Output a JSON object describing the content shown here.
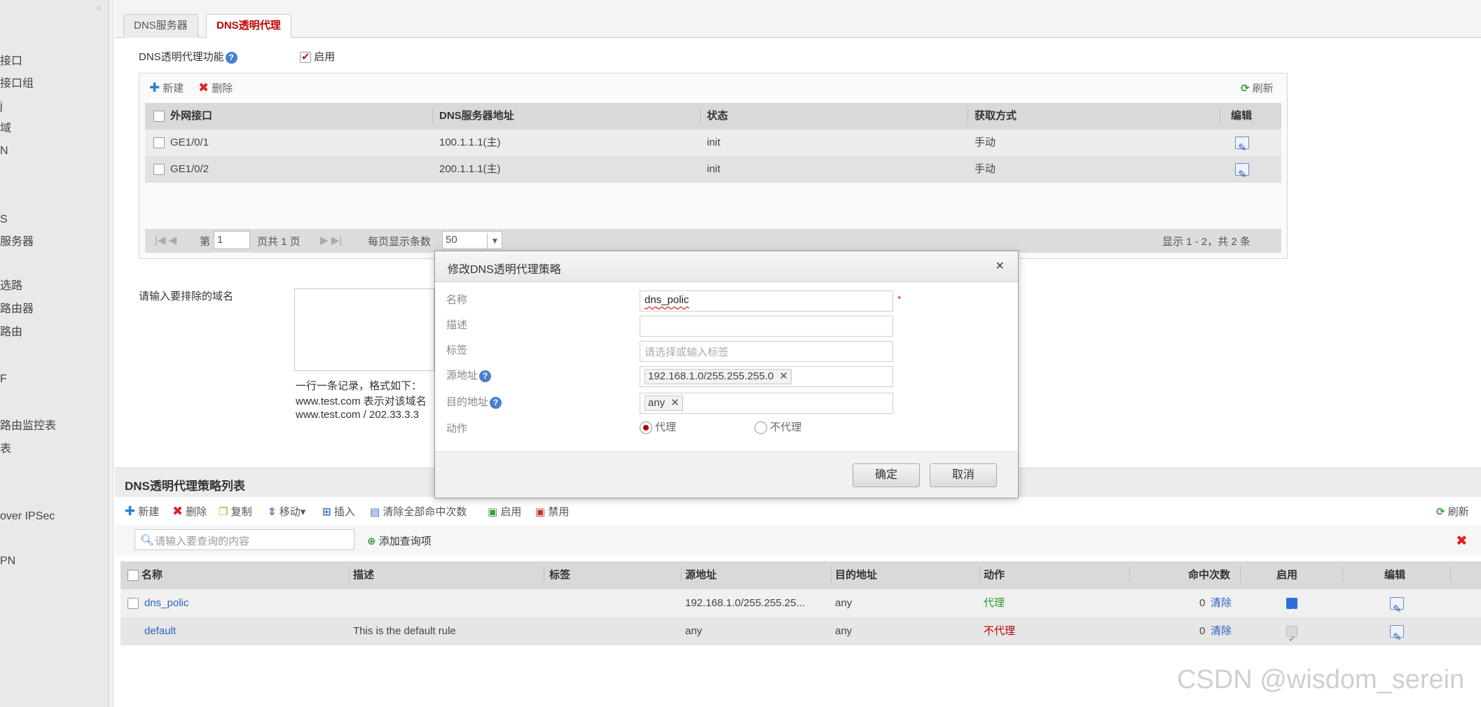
{
  "sidebar": {
    "items": [
      {
        "label": "接口",
        "top": 0
      },
      {
        "label": "接口组"
      },
      {
        "label": "j"
      },
      {
        "label": "域"
      },
      {
        "label": "N"
      },
      {
        "label": "S"
      },
      {
        "label": "服务器"
      },
      {
        "label": "选路"
      },
      {
        "label": "路由器"
      },
      {
        "label": "路由"
      },
      {
        "label": "F"
      },
      {
        "label": "路由监控表"
      },
      {
        "label": "表"
      },
      {
        "label": "over IPSec"
      },
      {
        "label": "PN"
      }
    ]
  },
  "tabs": {
    "dns_server": "DNS服务器",
    "dns_proxy": "DNS透明代理"
  },
  "proxy_feature": {
    "label": "DNS透明代理功能",
    "enable_label": "启用"
  },
  "upper_toolbar": {
    "new": "新建",
    "delete": "删除",
    "refresh": "刷新"
  },
  "upper_table": {
    "headers": [
      "外网接口",
      "DNS服务器地址",
      "状态",
      "获取方式",
      "编辑"
    ],
    "rows": [
      [
        "GE1/0/1",
        "100.1.1.1(主)",
        "init",
        "手动"
      ],
      [
        "GE1/0/2",
        "200.1.1.1(主)",
        "init",
        "手动"
      ]
    ]
  },
  "pager": {
    "page_prefix": "第",
    "page_value": "1",
    "page_suffix": "页共 1 页",
    "per_page_label": "每页显示条数",
    "per_page_value": "50",
    "summary": "显示 1 - 2，共 2 条"
  },
  "exclude_domain": {
    "label": "请输入要排除的域名",
    "hint_line1": "一行一条记录，格式如下：",
    "hint_line2": "www.test.com 表示对该域名",
    "hint_line3": "www.test.com / 202.33.3.3"
  },
  "policy_list": {
    "title": "DNS透明代理策略列表",
    "toolbar": {
      "new": "新建",
      "delete": "删除",
      "copy": "复制",
      "move": "移动▾",
      "insert": "插入",
      "clear_hits": "清除全部命中次数",
      "enable": "启用",
      "disable": "禁用",
      "refresh": "刷新"
    },
    "search_placeholder": "请输入要查询的内容",
    "add_query": "添加查询项",
    "headers": [
      "名称",
      "描述",
      "标签",
      "源地址",
      "目的地址",
      "动作",
      "命中次数",
      "启用",
      "编辑"
    ],
    "rows": [
      {
        "name": "dns_polic",
        "desc": "",
        "tag": "",
        "src": "192.168.1.0/255.255.25...",
        "dst": "any",
        "action": "代理",
        "hits": "0",
        "clear": "清除"
      },
      {
        "name": "default",
        "desc": "This is the default rule",
        "tag": "",
        "src": "any",
        "dst": "any",
        "action": "不代理",
        "hits": "0",
        "clear": "清除"
      }
    ]
  },
  "modal": {
    "title": "修改DNS透明代理策略",
    "close": "×",
    "labels": {
      "name": "名称",
      "desc": "描述",
      "tag": "标签",
      "src": "源地址",
      "dst": "目的地址",
      "action": "动作"
    },
    "name_value": "dns_polic",
    "tag_placeholder": "请选择或输入标签",
    "src_tag": "192.168.1.0/255.255.255.0",
    "dst_tag": "any",
    "action_proxy": "代理",
    "action_noproxy": "不代理",
    "ok": "确定",
    "cancel": "取消",
    "required_mark": "*"
  },
  "watermark": "CSDN @wisdom_serein"
}
